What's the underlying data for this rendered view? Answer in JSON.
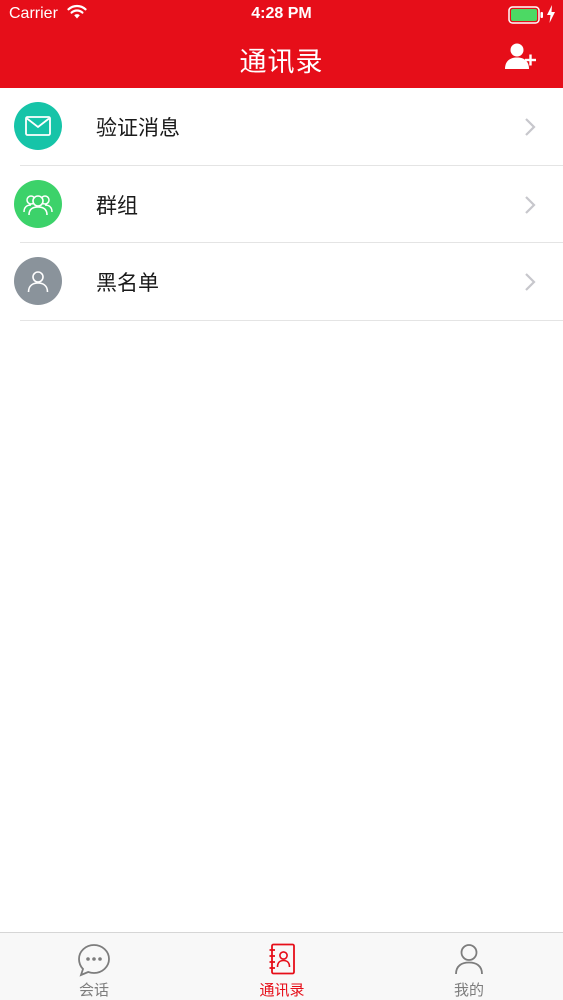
{
  "status_bar": {
    "carrier": "Carrier",
    "time": "4:28 PM"
  },
  "header": {
    "title": "通讯录",
    "add_icon": "add-contact-icon"
  },
  "colors": {
    "brand_red": "#e60e19",
    "verify_teal": "#16c4a8",
    "group_green": "#3cd26a",
    "blacklist_gray": "#8a939b"
  },
  "list": {
    "items": [
      {
        "label": "验证消息",
        "icon": "mail-icon"
      },
      {
        "label": "群组",
        "icon": "group-icon"
      },
      {
        "label": "黑名单",
        "icon": "person-icon"
      }
    ]
  },
  "tabbar": {
    "tabs": [
      {
        "label": "会话",
        "icon": "chat-bubble-icon",
        "active": false
      },
      {
        "label": "通讯录",
        "icon": "address-book-icon",
        "active": true
      },
      {
        "label": "我的",
        "icon": "profile-icon",
        "active": false
      }
    ]
  }
}
